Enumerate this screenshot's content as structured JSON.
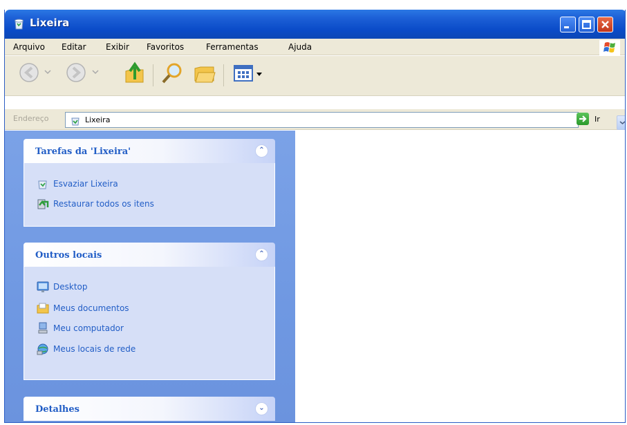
{
  "window": {
    "title": "Lixeira",
    "controls": [
      "minimize",
      "maximize",
      "close"
    ]
  },
  "menubar": {
    "items": [
      "Arquivo",
      "Editar",
      "Exibir",
      "Favoritos",
      "Ferramentas",
      "Ajuda"
    ]
  },
  "toolbar": {
    "buttons": [
      "back-icon",
      "forward-icon",
      "up-folder-icon",
      "search-icon",
      "folders-icon",
      "views-icon"
    ]
  },
  "addressbar": {
    "label": "Endereço",
    "value": "Lixeira",
    "go_label": "Ir"
  },
  "taskpane": {
    "panels": [
      {
        "title": "Tarefas da 'Lixeira'",
        "collapsed": false,
        "tasks": [
          {
            "label": "Esvaziar Lixeira",
            "icon": "empty-recycle-bin-icon"
          },
          {
            "label": "Restaurar todos os itens",
            "icon": "restore-all-icon"
          }
        ]
      },
      {
        "title": "Outros locais",
        "collapsed": false,
        "tasks": [
          {
            "label": "Desktop",
            "icon": "desktop-icon"
          },
          {
            "label": "Meus documentos",
            "icon": "my-documents-icon"
          },
          {
            "label": "Meu computador",
            "icon": "my-computer-icon"
          },
          {
            "label": "Meus locais de rede",
            "icon": "network-places-icon"
          }
        ]
      },
      {
        "title": "Detalhes",
        "collapsed": true,
        "tasks": []
      }
    ]
  },
  "colors": {
    "titlebar": "#0a4bc8",
    "taskpane": "#7ba2e7",
    "link": "#215dc6",
    "panel_body": "#d6dff7"
  }
}
